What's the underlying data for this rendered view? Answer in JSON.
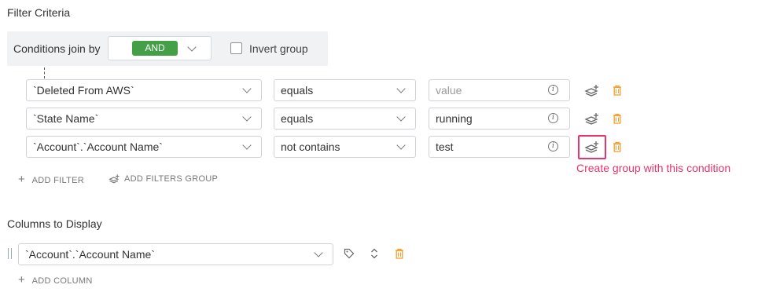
{
  "filter_criteria": {
    "title": "Filter Criteria",
    "join": {
      "label": "Conditions join by",
      "value": "AND",
      "value_color": "#43a047"
    },
    "invert": {
      "label": "Invert group",
      "checked": false
    },
    "rows": [
      {
        "field": "`Deleted From AWS`",
        "operator": "equals",
        "value": "",
        "value_placeholder": "value"
      },
      {
        "field": "`State Name`",
        "operator": "equals",
        "value": "running",
        "value_placeholder": ""
      },
      {
        "field": "`Account`.`Account Name`",
        "operator": "not contains",
        "value": "test",
        "value_placeholder": ""
      }
    ],
    "annotation": "Create group with this condition",
    "annotation_color": "#e8336b",
    "add_filter_label": "ADD FILTER",
    "add_group_label": "ADD FILTERS GROUP"
  },
  "columns": {
    "title": "Columns to Display",
    "items": [
      {
        "field": "`Account`.`Account Name`"
      }
    ],
    "add_column_label": "ADD COLUMN"
  },
  "colors": {
    "trash": "#f0a030",
    "icon": "#666"
  }
}
